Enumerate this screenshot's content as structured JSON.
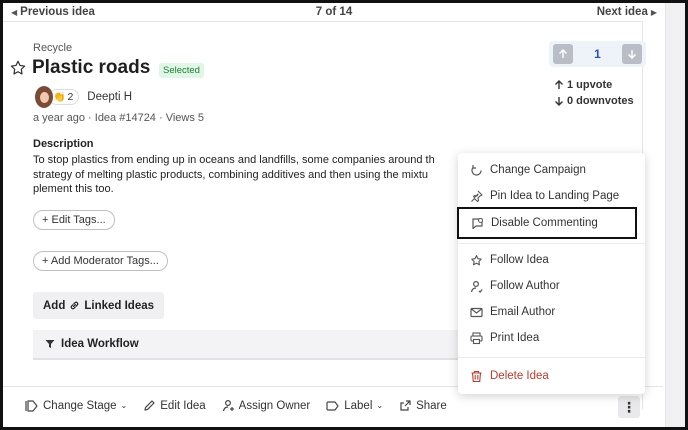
{
  "nav": {
    "prev_label": "Previous idea",
    "pager": "7 of 14",
    "next_label": "Next idea"
  },
  "idea": {
    "category": "Recycle",
    "title": "Plastic roads",
    "status_badge": "Selected",
    "reaction_count": "2",
    "author": "Deepti H",
    "meta": "a year ago · Idea #14724 · Views 5",
    "description_heading": "Description",
    "description_lines": [
      "To stop plastics from ending up in oceans and landfills, some companies around th",
      "strategy of melting plastic products, combining additives and then using the mixtu",
      "plement this too."
    ]
  },
  "votes": {
    "count": "1",
    "upvotes": "1 upvote",
    "downvotes": "0 downvotes"
  },
  "actions": {
    "edit_tags": "+ Edit Tags...",
    "moderator_tags": "+ Add Moderator Tags...",
    "linked_ideas_prefix": "Add",
    "linked_ideas_suffix": "Linked Ideas",
    "workflow": "Idea Workflow"
  },
  "menu": {
    "change_campaign": "Change Campaign",
    "pin_landing": "Pin Idea to Landing Page",
    "disable_commenting": "Disable Commenting",
    "follow_idea": "Follow Idea",
    "follow_author": "Follow Author",
    "email_author": "Email Author",
    "print_idea": "Print Idea",
    "delete_idea": "Delete Idea"
  },
  "footer": {
    "change_stage": "Change Stage",
    "edit_idea": "Edit Idea",
    "assign_owner": "Assign Owner",
    "label": "Label",
    "share": "Share",
    "more": "⋮"
  },
  "colors": {
    "selected_badge_bg": "#e0f7e6",
    "selected_badge_fg": "#1e7a3d",
    "vote_accent": "#2d4fbf",
    "danger": "#c0392b"
  }
}
